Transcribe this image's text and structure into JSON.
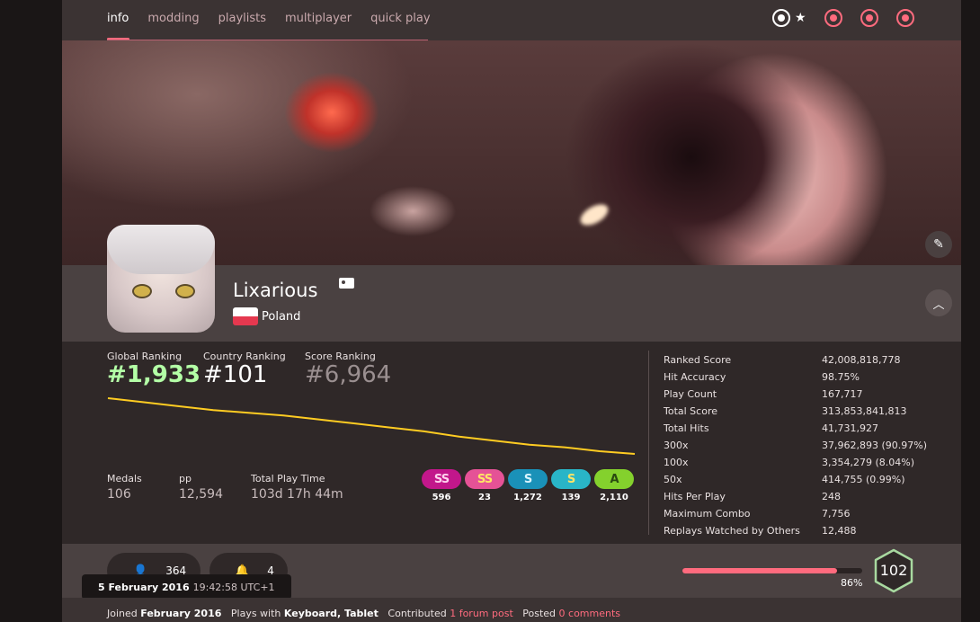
{
  "nav": {
    "tabs": [
      {
        "label": "info"
      },
      {
        "label": "modding"
      },
      {
        "label": "playlists"
      },
      {
        "label": "multiplayer"
      },
      {
        "label": "quick play"
      }
    ],
    "modes": [
      "osu-mode-icon",
      "taiko-mode-icon",
      "catch-mode-icon",
      "mania-mode-icon"
    ]
  },
  "user": {
    "username": "Lixarious",
    "country": "Poland"
  },
  "rankings": {
    "global_label": "Global Ranking",
    "global_value": "#1,933",
    "country_label": "Country Ranking",
    "country_value": "#101",
    "score_label": "Score Ranking",
    "score_value": "#6,964"
  },
  "rank_history": [
    18,
    21,
    24,
    27,
    29,
    31,
    34,
    37,
    40,
    43,
    47,
    50,
    53,
    55,
    58,
    60
  ],
  "misc": {
    "medals_label": "Medals",
    "medals_value": "106",
    "pp_label": "pp",
    "pp_value": "12,594",
    "playtime_label": "Total Play Time",
    "playtime_value": "103d 17h 44m"
  },
  "grades": [
    {
      "grade": "SS",
      "count": "596",
      "color": "#c2178b"
    },
    {
      "grade": "SS",
      "count": "23",
      "color": "#e55296"
    },
    {
      "grade": "S",
      "count": "1,272",
      "color": "#1a91b8"
    },
    {
      "grade": "S",
      "count": "139",
      "color": "#29b5c7"
    },
    {
      "grade": "A",
      "count": "2,110",
      "color": "#84d12d"
    }
  ],
  "details": [
    {
      "label": "Ranked Score",
      "value": "42,008,818,778"
    },
    {
      "label": "Hit Accuracy",
      "value": "98.75%"
    },
    {
      "label": "Play Count",
      "value": "167,717"
    },
    {
      "label": "Total Score",
      "value": "313,853,841,813"
    },
    {
      "label": "Total Hits",
      "value": "41,731,927"
    },
    {
      "label": "300x",
      "value": "37,962,893 (90.97%)"
    },
    {
      "label": "100x",
      "value": "3,354,279 (8.04%)"
    },
    {
      "label": "50x",
      "value": "414,755 (0.99%)"
    },
    {
      "label": "Hits Per Play",
      "value": "248"
    },
    {
      "label": "Maximum Combo",
      "value": "7,756"
    },
    {
      "label": "Replays Watched by Others",
      "value": "12,488"
    }
  ],
  "social": {
    "followers": "364",
    "mapping_subs": "4"
  },
  "level": {
    "value": "102",
    "progress_label": "86%",
    "progress": 0.86
  },
  "tooltip": {
    "date": "5 February 2016",
    "time": "19:42:58 UTC+1"
  },
  "info": {
    "joined_label": "Joined",
    "joined_value": "February 2016",
    "plays_label": "Plays with",
    "plays_value": "Keyboard, Tablet",
    "contributed_label": "Contributed",
    "contributed_value": "1 forum post",
    "posted_label": "Posted",
    "posted_value": "0 comments"
  },
  "colors": {
    "accent": "#ff6b7e",
    "global_rank": "#b3ffa6",
    "chart_line": "#ffcc22"
  }
}
